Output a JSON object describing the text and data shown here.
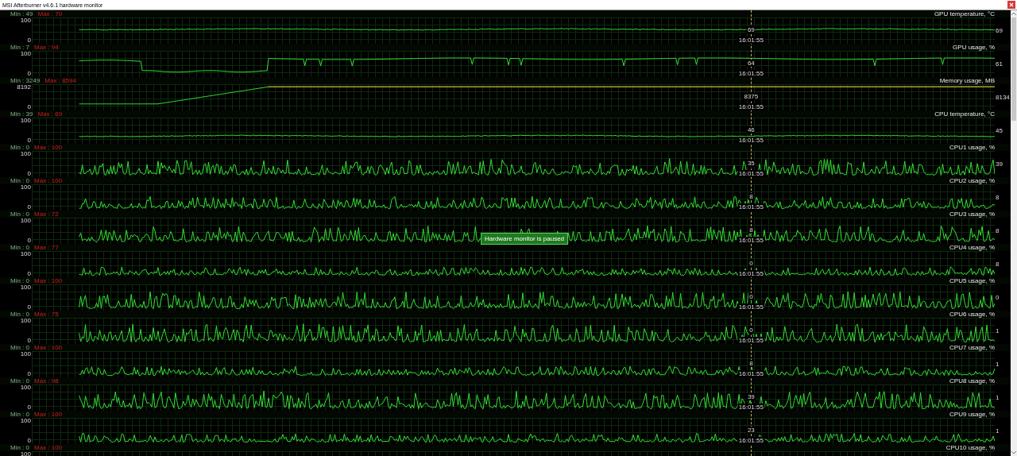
{
  "window": {
    "title": "MSI Afterburner v4.6.1 hardware monitor"
  },
  "tooltip": "Hardware monitor is paused",
  "panels": [
    {
      "title": "GPU temperature, °C",
      "kind": "smooth",
      "min": "Min : 49",
      "max": "Max : 70",
      "axis_max": "100",
      "axis_min": "0",
      "current": "69",
      "cursor_value": "69",
      "cursor_time": "16:01:55"
    },
    {
      "title": "GPU usage, %",
      "kind": "usage",
      "min": "Min : 7",
      "max": "Max : 94",
      "axis_max": "100",
      "axis_min": "0",
      "current": "61",
      "cursor_value": "64",
      "cursor_time": "16:01:55"
    },
    {
      "title": "Memory usage, MB",
      "kind": "memory",
      "min": "Min : 3249",
      "max": "Max : 8594",
      "axis_max": "8192",
      "axis_min": "0",
      "current": "8134",
      "cursor_value": "8375",
      "cursor_time": "16:01:55"
    },
    {
      "title": "CPU temperature, °C",
      "kind": "smooth",
      "min": "Min : 39",
      "max": "Max : 69",
      "axis_max": "100",
      "axis_min": "0",
      "current": "45",
      "cursor_value": "46",
      "cursor_time": "16:01:55"
    },
    {
      "title": "CPU1 usage, %",
      "kind": "spiky",
      "min": "Min : 0",
      "max": "Max : 100",
      "axis_max": "100",
      "axis_min": "0",
      "current": "39",
      "cursor_value": "35",
      "cursor_time": "16:01:55"
    },
    {
      "title": "CPU2 usage, %",
      "kind": "spiky",
      "min": "Min : 0",
      "max": "Max : 100",
      "axis_max": "100",
      "axis_min": "0",
      "current": "8",
      "cursor_value": "8",
      "cursor_time": "16:01:55"
    },
    {
      "title": "CPU3 usage, %",
      "kind": "spiky",
      "min": "Min : 0",
      "max": "Max : 72",
      "axis_max": "100",
      "axis_min": "0",
      "current": "8",
      "cursor_value": "8",
      "cursor_time": "16:01:55"
    },
    {
      "title": "CPU4 usage, %",
      "kind": "spiky",
      "min": "Min : 0",
      "max": "Max : 77",
      "axis_max": "100",
      "axis_min": "0",
      "current": "8",
      "cursor_value": "0",
      "cursor_time": "16:01:55"
    },
    {
      "title": "CPU5 usage, %",
      "kind": "spiky",
      "min": "Min : 0",
      "max": "Max : 100",
      "axis_max": "100",
      "axis_min": "0",
      "current": "0",
      "cursor_value": "0",
      "cursor_time": "16:01:55"
    },
    {
      "title": "CPU6 usage, %",
      "kind": "spiky",
      "min": "Min : 0",
      "max": "Max : 75",
      "axis_max": "100",
      "axis_min": "0",
      "current": "1",
      "cursor_value": "0",
      "cursor_time": "16:01:55"
    },
    {
      "title": "CPU7 usage, %",
      "kind": "spiky",
      "min": "Min : 0",
      "max": "Max : 100",
      "axis_max": "100",
      "axis_min": "0",
      "current": "1",
      "cursor_value": "8",
      "cursor_time": "16:01:55"
    },
    {
      "title": "CPU8 usage, %",
      "kind": "spiky",
      "min": "Min : 0",
      "max": "Max : 98",
      "axis_max": "100",
      "axis_min": "0",
      "current": "1",
      "cursor_value": "39",
      "cursor_time": "16:01:55"
    },
    {
      "title": "CPU9 usage, %",
      "kind": "spiky",
      "min": "Min : 0",
      "max": "Max : 100",
      "axis_max": "100",
      "axis_min": "0",
      "current": "1",
      "cursor_value": "23",
      "cursor_time": "16:01:55"
    },
    {
      "title": "CPU10 usage, %",
      "kind": "spiky",
      "min": "Min : 0",
      "max": "Max : 100",
      "axis_max": "100"
    }
  ]
}
